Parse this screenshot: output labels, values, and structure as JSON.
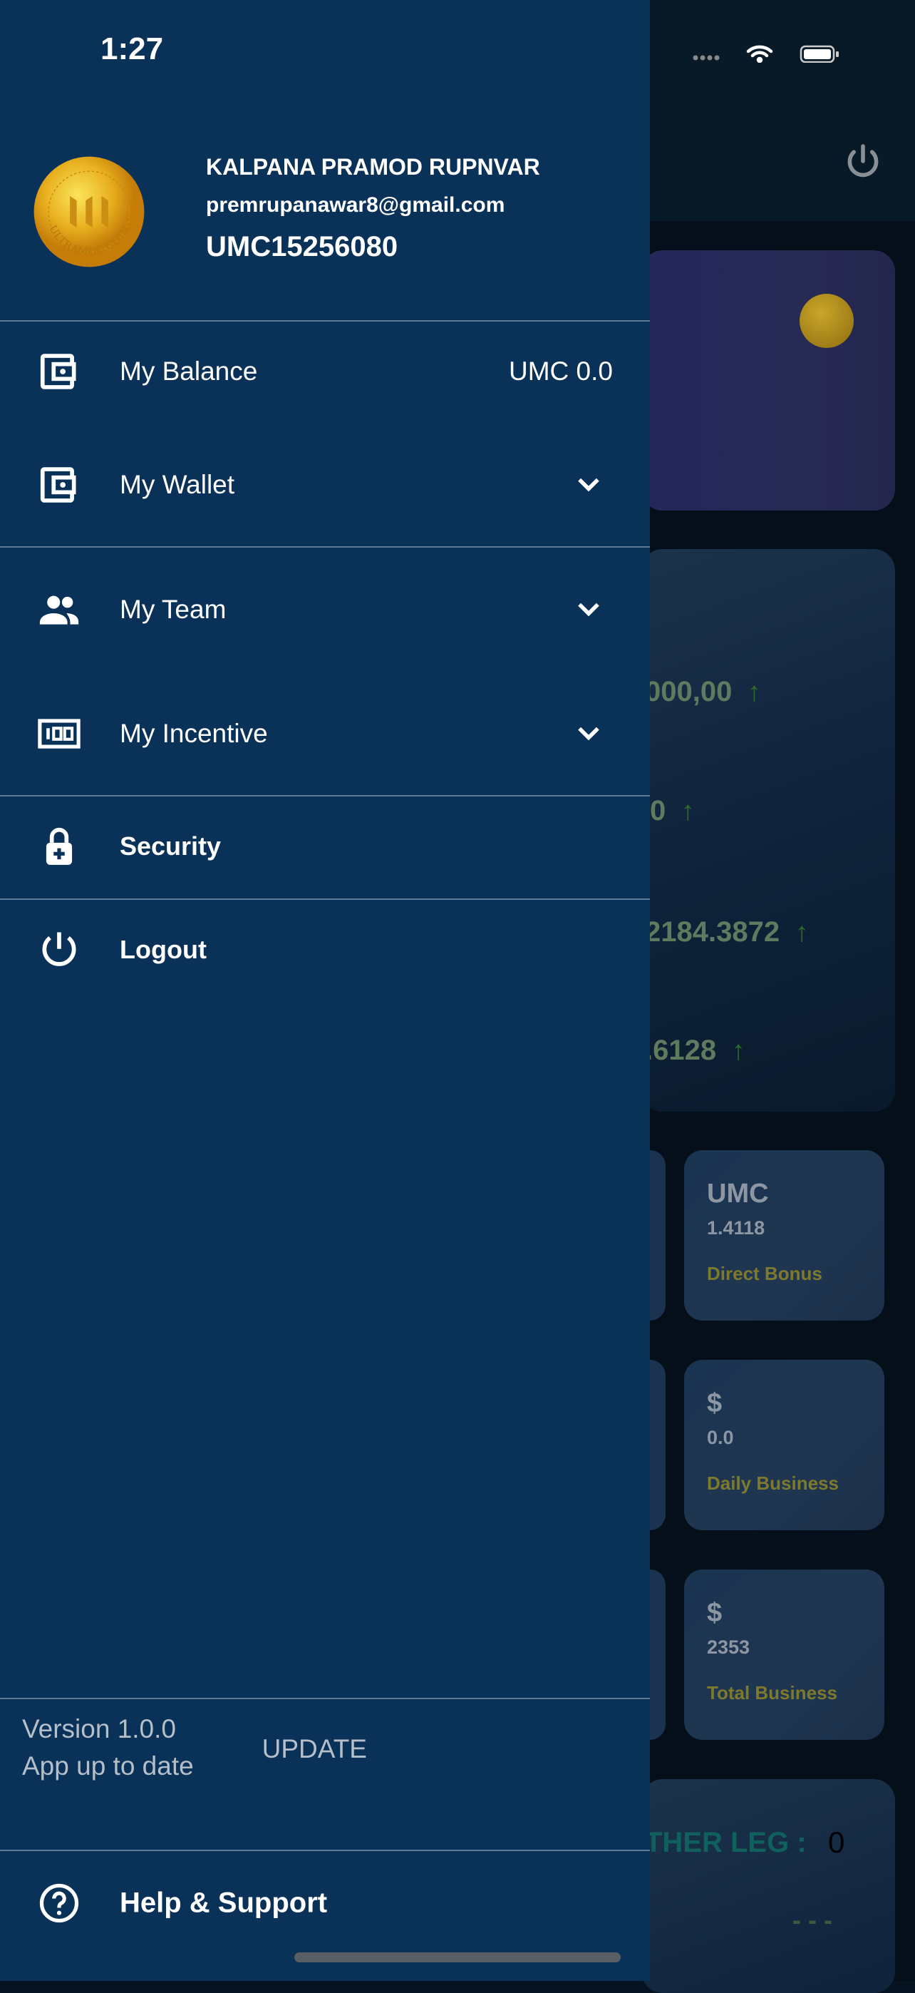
{
  "status_bar": {
    "time": "1:27"
  },
  "profile": {
    "name": "KALPANA PRAMOD RUPNVAR",
    "email": "premrupanawar8@gmail.com",
    "user_id": "UMC15256080",
    "avatar_text": "ULTRAMOC COIN"
  },
  "menu": {
    "balance": {
      "label": "My Balance",
      "value": "UMC 0.0",
      "icon": "wallet-icon"
    },
    "wallet": {
      "label": "My Wallet",
      "icon": "wallet-icon"
    },
    "team": {
      "label": "My Team",
      "icon": "people-icon"
    },
    "incentive": {
      "label": "My Incentive",
      "icon": "counter-icon"
    },
    "security": {
      "label": "Security",
      "icon": "lock-icon"
    },
    "logout": {
      "label": "Logout",
      "icon": "power-icon"
    }
  },
  "version": {
    "version": "Version 1.0.0",
    "status": "App up to date",
    "update": "UPDATE"
  },
  "help": {
    "label": "Help & Support",
    "icon": "help-icon"
  },
  "background": {
    "values": [
      "000,00",
      "0",
      "2184.3872",
      ".6128"
    ],
    "cards": [
      {
        "title": "UMC",
        "value": "1.4118",
        "label": "Direct Bonus"
      },
      {
        "title": "$",
        "value": "0.0",
        "label": "Daily Business"
      },
      {
        "title": "$",
        "value": "2353",
        "label": "Total Business"
      }
    ],
    "leg_label": "THER LEG :",
    "leg_value": "0",
    "leg_dashes": "- - -"
  },
  "colors": {
    "drawer": "#0a3158",
    "accent_green": "#2c6a2c",
    "label_gold": "#7d7a2e"
  }
}
